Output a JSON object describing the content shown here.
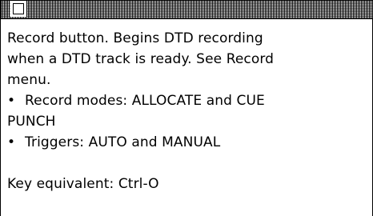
{
  "window": {
    "close_box_icon": "close-box-icon"
  },
  "help": {
    "description_lines": [
      "Record button. Begins DTD recording",
      "when a DTD track is ready. See Record",
      "menu."
    ],
    "bullets": [
      {
        "symbol": "•",
        "text": "Record modes: ALLOCATE and CUE",
        "continuation": "PUNCH"
      },
      {
        "symbol": "•",
        "text": "Triggers: AUTO and MANUAL"
      }
    ],
    "key_equivalent": {
      "label": "Key equivalent:",
      "value": "Ctrl-O"
    }
  }
}
